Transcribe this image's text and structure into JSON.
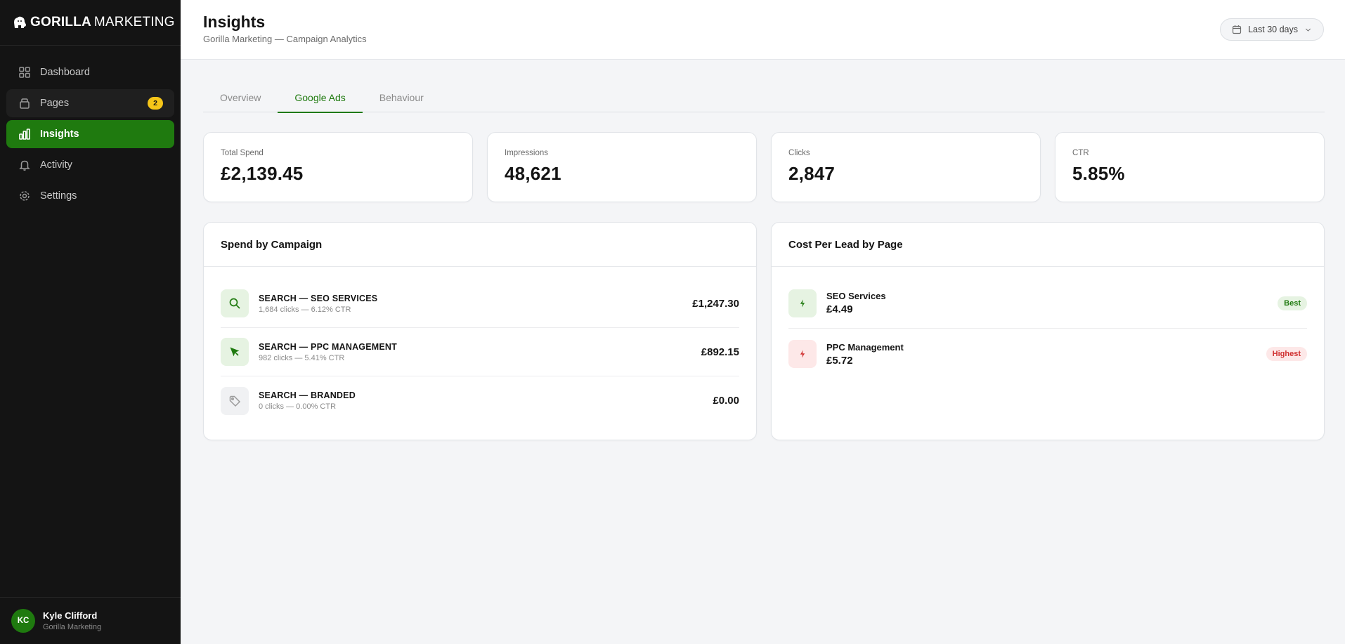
{
  "brand": {
    "bold": "GORILLA",
    "light": "MARKETING"
  },
  "sidebar": {
    "items": [
      {
        "label": "Dashboard",
        "icon": "grid-icon"
      },
      {
        "label": "Pages",
        "icon": "layers-icon",
        "badge": "2"
      },
      {
        "label": "Insights",
        "icon": "bar-chart-icon"
      },
      {
        "label": "Activity",
        "icon": "bell-icon"
      },
      {
        "label": "Settings",
        "icon": "gear-icon"
      }
    ]
  },
  "user": {
    "initials": "KC",
    "name": "Kyle Clifford",
    "org": "Gorilla Marketing"
  },
  "header": {
    "title": "Insights",
    "subtitle": "Gorilla Marketing — Campaign Analytics",
    "date_range": "Last 30 days"
  },
  "tabs": [
    {
      "label": "Overview"
    },
    {
      "label": "Google Ads"
    },
    {
      "label": "Behaviour"
    }
  ],
  "stats": [
    {
      "label": "Total Spend",
      "value": "£2,139.45"
    },
    {
      "label": "Impressions",
      "value": "48,621"
    },
    {
      "label": "Clicks",
      "value": "2,847"
    },
    {
      "label": "CTR",
      "value": "5.85%"
    }
  ],
  "spend_panel": {
    "title": "Spend by Campaign",
    "rows": [
      {
        "name": "SEARCH — SEO SERVICES",
        "meta": "1,684 clicks — 6.12% CTR",
        "amount": "£1,247.30",
        "icon": "search-icon"
      },
      {
        "name": "SEARCH — PPC MANAGEMENT",
        "meta": "982 clicks — 5.41% CTR",
        "amount": "£892.15",
        "icon": "cursor-icon"
      },
      {
        "name": "SEARCH — BRANDED",
        "meta": "0 clicks — 0.00% CTR",
        "amount": "£0.00",
        "icon": "tag-icon"
      }
    ]
  },
  "lead_panel": {
    "title": "Cost Per Lead by Page",
    "rows": [
      {
        "name": "SEO Services",
        "value": "£4.49",
        "badge": "Best",
        "icon": "bolt-icon"
      },
      {
        "name": "PPC Management",
        "value": "£5.72",
        "badge": "Highest",
        "icon": "bolt-icon"
      }
    ]
  },
  "colors": {
    "accent": "#1f7a0f",
    "sidebar_bg": "#141414",
    "badge": "#f5c518",
    "danger": "#d03030"
  }
}
